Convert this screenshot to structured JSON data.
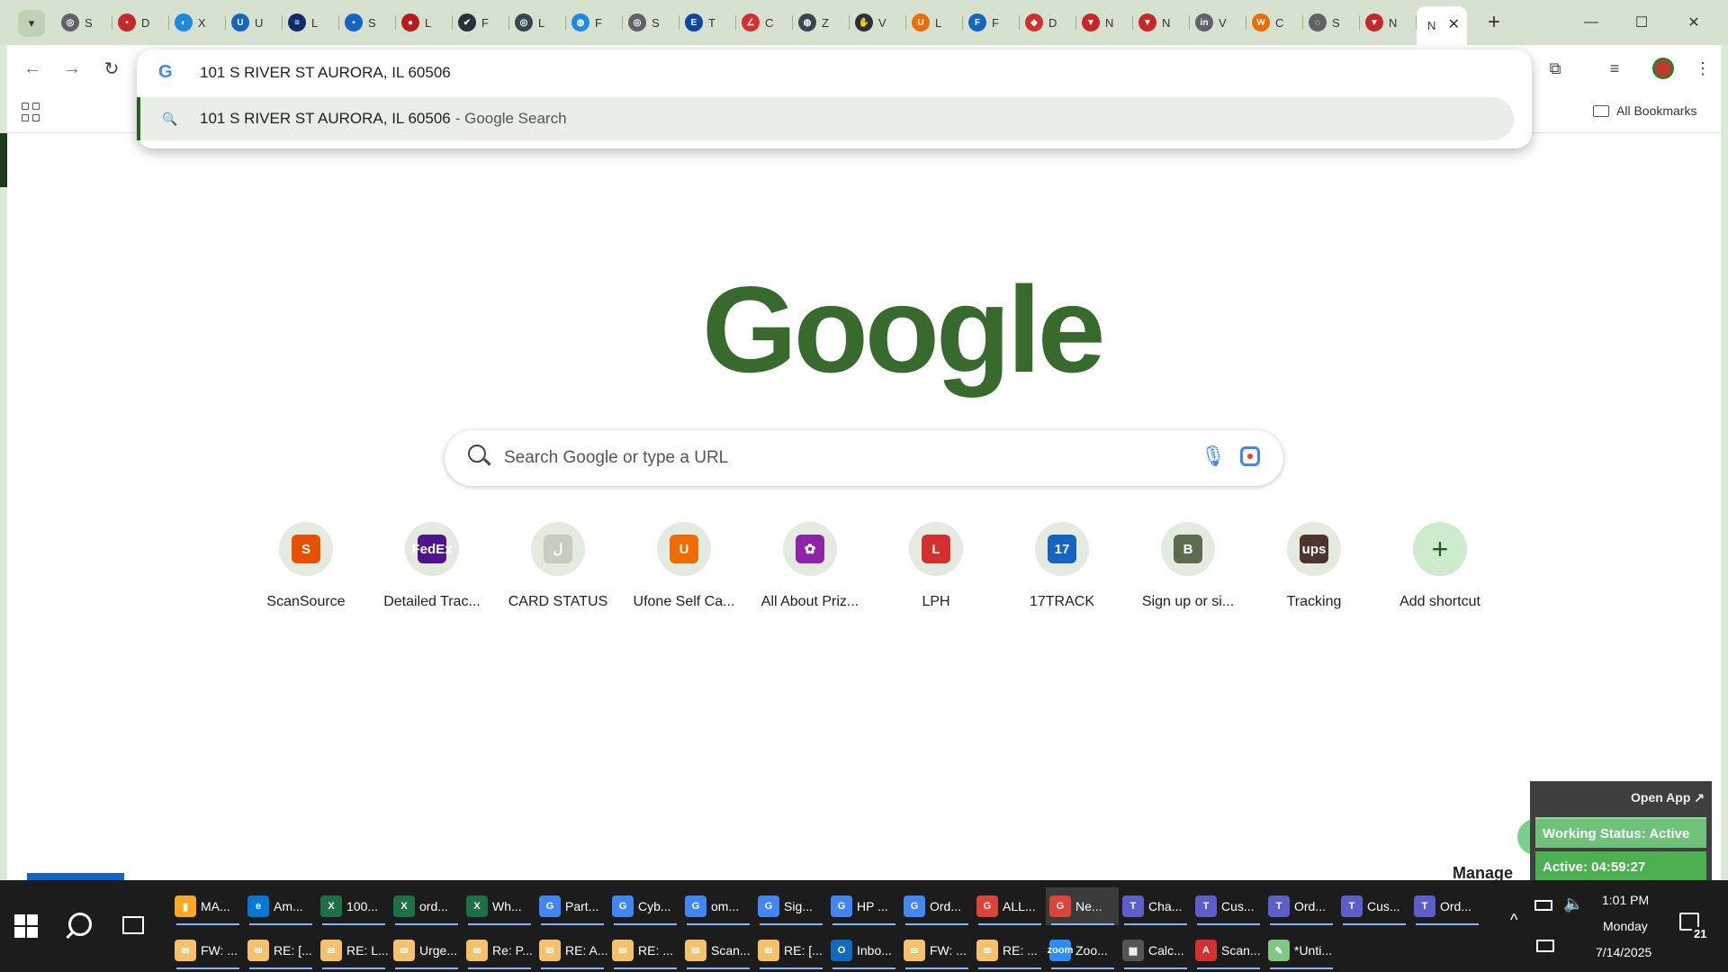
{
  "browser": {
    "tabs": [
      {
        "label": "S",
        "color": "#5f6368",
        "glyph": "◎"
      },
      {
        "label": "D",
        "color": "#c62828",
        "glyph": "▪"
      },
      {
        "label": "X",
        "color": "#1e88e5",
        "glyph": "◐"
      },
      {
        "label": "U",
        "color": "#1565c0",
        "glyph": "U"
      },
      {
        "label": "L",
        "color": "#0d2c6b",
        "glyph": "≡"
      },
      {
        "label": "S",
        "color": "#1565c0",
        "glyph": "▪"
      },
      {
        "label": "L",
        "color": "#b71c1c",
        "glyph": "●"
      },
      {
        "label": "F",
        "color": "#263238",
        "glyph": "✔"
      },
      {
        "label": "L",
        "color": "#37474f",
        "glyph": "◎"
      },
      {
        "label": "F",
        "color": "#1e88e5",
        "glyph": "◍"
      },
      {
        "label": "S",
        "color": "#5f6368",
        "glyph": "◎"
      },
      {
        "label": "T",
        "color": "#0d47a1",
        "glyph": "E"
      },
      {
        "label": "C",
        "color": "#d32f2f",
        "glyph": "∠"
      },
      {
        "label": "Z",
        "color": "#37474f",
        "glyph": "◍"
      },
      {
        "label": "V",
        "color": "#263238",
        "glyph": "✋"
      },
      {
        "label": "L",
        "color": "#ef6c00",
        "glyph": "U"
      },
      {
        "label": "F",
        "color": "#1565c0",
        "glyph": "F"
      },
      {
        "label": "D",
        "color": "#d32f2f",
        "glyph": "◆"
      },
      {
        "label": "N",
        "color": "#c62828",
        "glyph": "▼"
      },
      {
        "label": "N",
        "color": "#c62828",
        "glyph": "▼"
      },
      {
        "label": "V",
        "color": "#5f6368",
        "glyph": "in"
      },
      {
        "label": "C",
        "color": "#ef6c00",
        "glyph": "W"
      },
      {
        "label": "S",
        "color": "#5f6368",
        "glyph": "◌"
      },
      {
        "label": "N",
        "color": "#c62828",
        "glyph": "▼"
      }
    ],
    "active_tab_label": "N",
    "window": {
      "minimize": "—",
      "maximize": "☐",
      "close": "✕"
    },
    "toolbar": {
      "back": "←",
      "forward": "→",
      "reload": "↻"
    },
    "omnibox": {
      "value": "101 S RIVER ST AURORA, IL 60506",
      "suggestion_text": "101 S RIVER ST AURORA, IL 60506",
      "suggestion_suffix": "- Google Search"
    },
    "bookmarks": {
      "all_bookmarks": "All Bookmarks"
    }
  },
  "newtab": {
    "logo": "Google",
    "search_placeholder": "Search Google or type a URL",
    "shortcuts": [
      {
        "label": "ScanSource",
        "glyph": "S",
        "color": "#e65100"
      },
      {
        "label": "Detailed Trac...",
        "glyph": "FedEx",
        "color": "#4d148c"
      },
      {
        "label": "CARD STATUS",
        "glyph": "ل",
        "color": "#c5ccc0"
      },
      {
        "label": "Ufone Self Ca...",
        "glyph": "U",
        "color": "#ef6c00"
      },
      {
        "label": "All About Priz...",
        "glyph": "✿",
        "color": "#8e24aa"
      },
      {
        "label": "LPH",
        "glyph": "L",
        "color": "#d32f2f"
      },
      {
        "label": "17TRACK",
        "glyph": "17",
        "color": "#1565c0"
      },
      {
        "label": "Sign up or si...",
        "glyph": "B",
        "color": "#5d6b4f"
      },
      {
        "label": "Tracking",
        "glyph": "ups",
        "color": "#4e342e"
      }
    ],
    "add_shortcut": "Add shortcut"
  },
  "widget": {
    "open_app": "Open App ↗",
    "working_status": "Working Status: Active",
    "active_timer": "Active: 04:59:27",
    "manage_peek": "Manage"
  },
  "taskbar": {
    "row1": [
      {
        "label": "MA...",
        "color": "#f9a825",
        "glyph": "▮"
      },
      {
        "label": "Am...",
        "color": "#0078d4",
        "glyph": "e"
      },
      {
        "label": "100...",
        "color": "#1e7145",
        "glyph": "X"
      },
      {
        "label": "ord...",
        "color": "#1e7145",
        "glyph": "X"
      },
      {
        "label": "Wh...",
        "color": "#1e7145",
        "glyph": "X"
      },
      {
        "label": "Part...",
        "color": "#4285f4",
        "glyph": "G"
      },
      {
        "label": "Cyb...",
        "color": "#4285f4",
        "glyph": "G"
      },
      {
        "label": "om...",
        "color": "#4285f4",
        "glyph": "G"
      },
      {
        "label": "Sig...",
        "color": "#4285f4",
        "glyph": "G"
      },
      {
        "label": "HP ...",
        "color": "#4285f4",
        "glyph": "G"
      },
      {
        "label": "Ord...",
        "color": "#4285f4",
        "glyph": "G"
      },
      {
        "label": "ALL...",
        "color": "#db4437",
        "glyph": "G"
      },
      {
        "label": "Ne...",
        "color": "#db4437",
        "glyph": "G",
        "active": true
      },
      {
        "label": "Cha...",
        "color": "#5b5fc7",
        "glyph": "T"
      },
      {
        "label": "Cus...",
        "color": "#5b5fc7",
        "glyph": "T"
      },
      {
        "label": "Ord...",
        "color": "#5b5fc7",
        "glyph": "T"
      },
      {
        "label": "Cus...",
        "color": "#5b5fc7",
        "glyph": "T"
      },
      {
        "label": "Ord...",
        "color": "#5b5fc7",
        "glyph": "T"
      }
    ],
    "row2": [
      {
        "label": "FW: ...",
        "color": "#f5c16c",
        "glyph": "✉"
      },
      {
        "label": "RE: [...",
        "color": "#f5c16c",
        "glyph": "✉"
      },
      {
        "label": "RE: L...",
        "color": "#f5c16c",
        "glyph": "✉"
      },
      {
        "label": "Urge...",
        "color": "#f5c16c",
        "glyph": "✉"
      },
      {
        "label": "Re: P...",
        "color": "#f5c16c",
        "glyph": "✉"
      },
      {
        "label": "RE: A...",
        "color": "#f5c16c",
        "glyph": "✉"
      },
      {
        "label": "RE: ...",
        "color": "#f5c16c",
        "glyph": "✉"
      },
      {
        "label": "Scan...",
        "color": "#f5c16c",
        "glyph": "✉"
      },
      {
        "label": "RE: [...",
        "color": "#f5c16c",
        "glyph": "✉"
      },
      {
        "label": "Inbo...",
        "color": "#0f6cbd",
        "glyph": "O"
      },
      {
        "label": "FW: ...",
        "color": "#f5c16c",
        "glyph": "✉"
      },
      {
        "label": "RE: ...",
        "color": "#f5c16c",
        "glyph": "✉"
      },
      {
        "label": "Zoo...",
        "color": "#2d8cff",
        "glyph": "zoom"
      },
      {
        "label": "Calc...",
        "color": "#555555",
        "glyph": "▦"
      },
      {
        "label": "Scan...",
        "color": "#d32f2f",
        "glyph": "A"
      },
      {
        "label": "*Unti...",
        "color": "#81c784",
        "glyph": "✎"
      }
    ],
    "clock": {
      "time": "1:01 PM",
      "day": "Monday",
      "date": "7/14/2025"
    },
    "notification_count": "21"
  }
}
